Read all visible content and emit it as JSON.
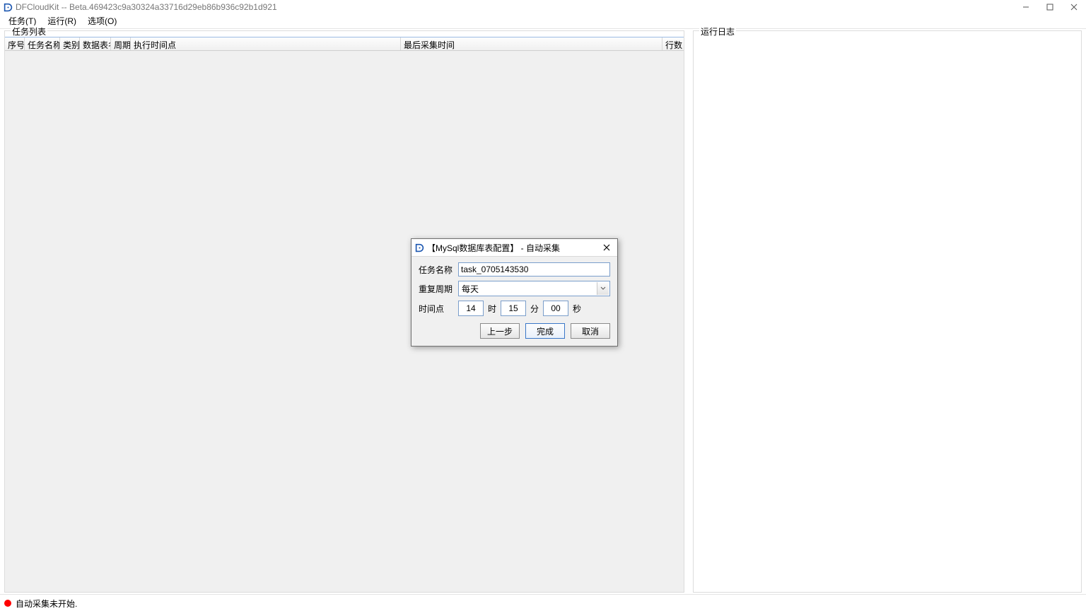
{
  "window": {
    "title": "DFCloudKit -- Beta.469423c9a30324a33716d29eb86b936c92b1d921"
  },
  "menu": {
    "tasks": "任务(T)",
    "run": "运行(R)",
    "options": "选项(O)"
  },
  "panels": {
    "task_list_title": "任务列表",
    "log_title": "运行日志"
  },
  "grid_headers": {
    "seq": "序号",
    "name": "任务名称",
    "type": "类别",
    "table": "数据表名",
    "period": "周期",
    "exec_time": "执行时间点",
    "last_collect": "最后采集时间",
    "row_count": "行数"
  },
  "status": {
    "text": "自动采集未开始."
  },
  "dialog": {
    "title": "【MySql数据库表配置】 - 自动采集",
    "label_name": "任务名称",
    "name_value": "task_0705143530",
    "label_repeat": "重复周期",
    "repeat_value": "每天",
    "label_time": "时间点",
    "time_h": "14",
    "sep_h": "时",
    "time_m": "15",
    "sep_m": "分",
    "time_s": "00",
    "sep_s": "秒",
    "btn_prev": "上一步",
    "btn_finish": "完成",
    "btn_cancel": "取消"
  }
}
